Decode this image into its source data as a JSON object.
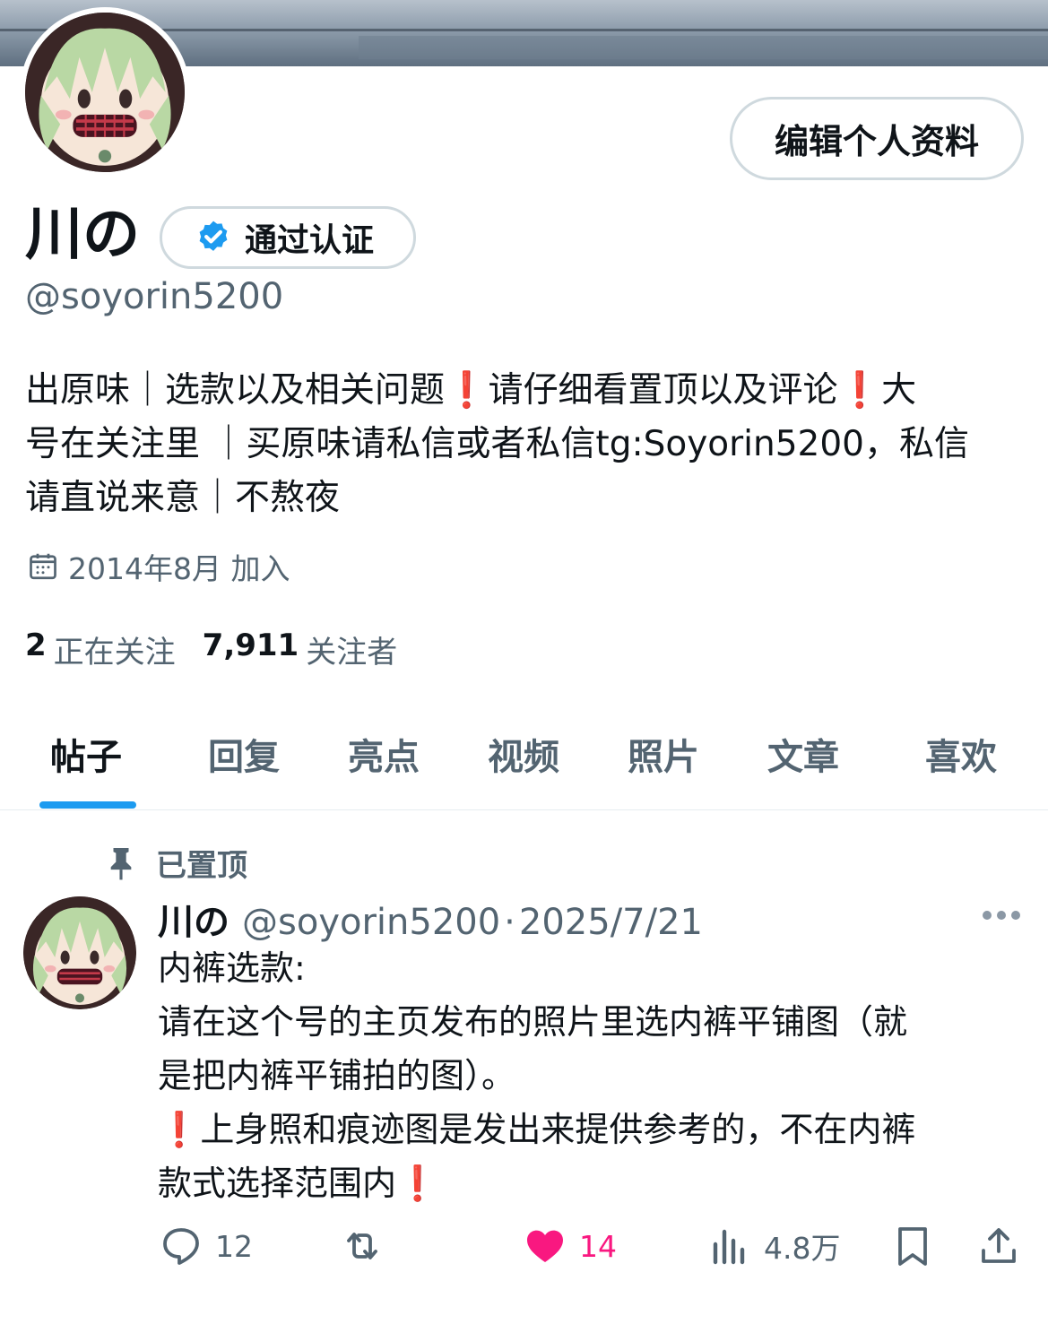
{
  "profile": {
    "name": "川の",
    "handle": "@soyorin5200",
    "edit_label": "编辑个人资料",
    "verify_label": "通过认证",
    "bio_lines": [
      "出原味｜选款以及相关问题❗️请仔细看置顶以及评论❗️大",
      "号在关注里 ｜买原味请私信或者私信tg:Soyorin5200，私信",
      "请直说来意｜不熬夜"
    ],
    "joined": "2014年8月 加入",
    "following_count": "2",
    "following_label": "正在关注",
    "followers_count": "7,911",
    "followers_label": "关注者"
  },
  "tabs": [
    {
      "label": "帖子",
      "active": true
    },
    {
      "label": "回复"
    },
    {
      "label": "亮点"
    },
    {
      "label": "视频"
    },
    {
      "label": "照片"
    },
    {
      "label": "文章"
    },
    {
      "label": "喜欢"
    }
  ],
  "pinned_tweet": {
    "pinned_label": "已置顶",
    "name": "川の",
    "handle": "@soyorin5200",
    "separator": "·",
    "date": "2025/7/21",
    "body_lines": [
      "内裤选款:",
      " 请在这个号的主页发布的照片里选内裤平铺图（就",
      "是把内裤平铺拍的图）。",
      "❗️上身照和痕迹图是发出来提供参考的，不在内裤",
      "款式选择范围内❗️"
    ],
    "replies": "12",
    "likes": "14",
    "views": "4.8万"
  },
  "colors": {
    "accent": "#1d9bf0",
    "like": "#f91880",
    "muted": "#536471",
    "text": "#0f1419"
  },
  "icons": [
    "verified-badge-icon",
    "calendar-icon",
    "pin-icon",
    "more-icon",
    "reply-icon",
    "retweet-icon",
    "like-icon",
    "views-icon",
    "bookmark-icon",
    "share-icon"
  ]
}
